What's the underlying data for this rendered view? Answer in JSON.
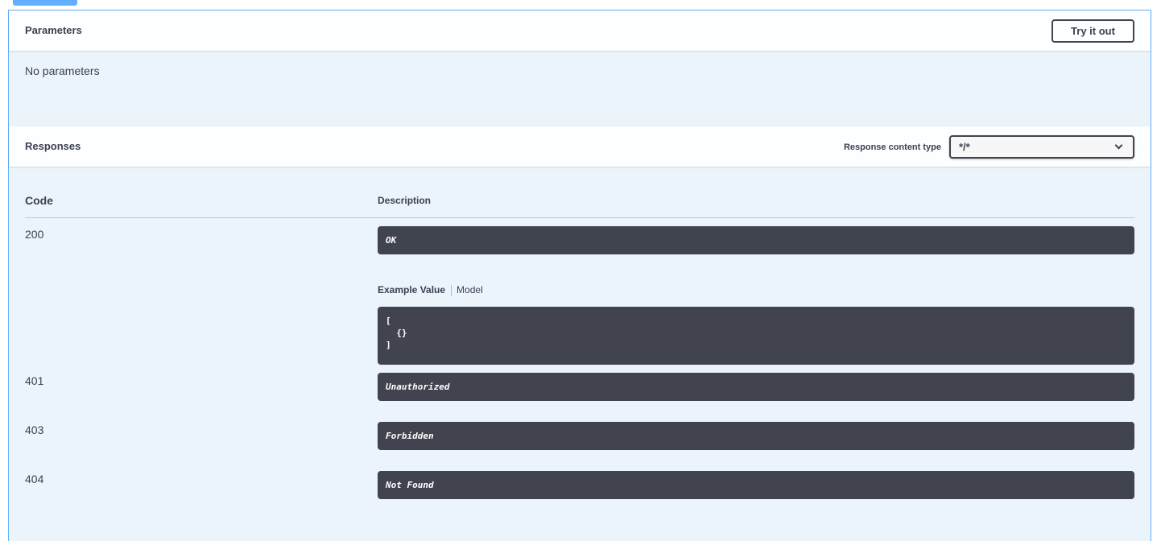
{
  "parameters": {
    "title": "Parameters",
    "try_button": "Try it out",
    "empty_text": "No parameters"
  },
  "responses": {
    "title": "Responses",
    "content_type_label": "Response content type",
    "content_type_value": "*/*",
    "table_headers": {
      "code": "Code",
      "description": "Description"
    },
    "rows": [
      {
        "code": "200",
        "description": "OK"
      },
      {
        "code": "401",
        "description": "Unauthorized"
      },
      {
        "code": "403",
        "description": "Forbidden"
      },
      {
        "code": "404",
        "description": "Not Found"
      }
    ],
    "example_tabs": {
      "active": "Example Value",
      "other": "Model"
    },
    "example_value": "[\n  {}\n]"
  },
  "colors": {
    "get_accent": "#61affe",
    "block_bg": "#ebf3fb",
    "code_bg": "#41444e"
  }
}
